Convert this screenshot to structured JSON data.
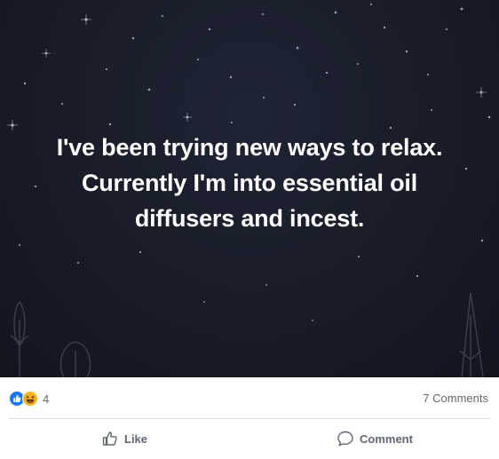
{
  "post": {
    "text_lines": [
      "I've been trying new ways to relax.",
      "Currently I'm into essential oil",
      "diffusers and incest."
    ],
    "background_color": "#181c28",
    "text_color": "#ffffff"
  },
  "stats": {
    "reactions": [
      "like-icon",
      "haha-icon"
    ],
    "reaction_count": "4",
    "comments_label": "7 Comments"
  },
  "actions": {
    "like_label": "Like",
    "comment_label": "Comment"
  },
  "colors": {
    "like_blue": "#1877f2",
    "haha_yellow": "#f7b125",
    "secondary_text": "#606770",
    "divider": "#dadde1"
  }
}
